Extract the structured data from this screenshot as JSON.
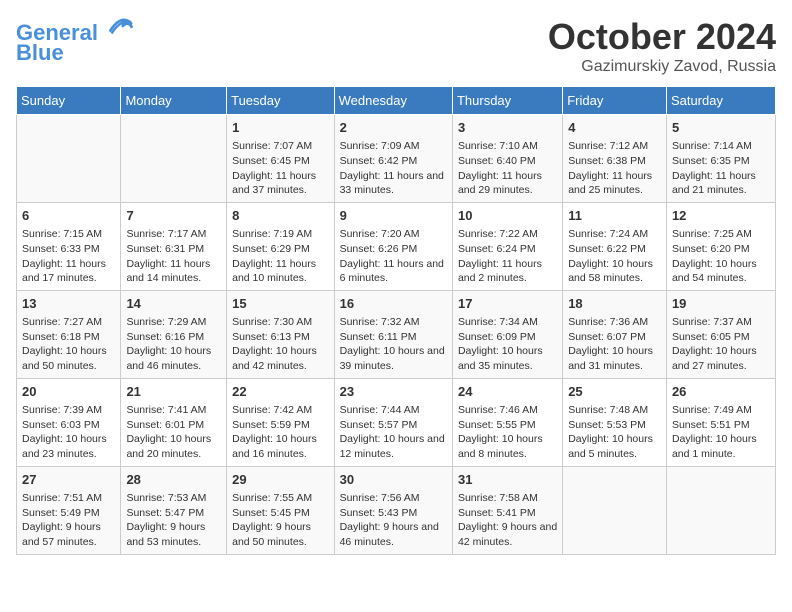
{
  "header": {
    "logo_line1": "General",
    "logo_line2": "Blue",
    "month": "October 2024",
    "location": "Gazimurskiy Zavod, Russia"
  },
  "weekdays": [
    "Sunday",
    "Monday",
    "Tuesday",
    "Wednesday",
    "Thursday",
    "Friday",
    "Saturday"
  ],
  "weeks": [
    [
      {
        "day": "",
        "detail": ""
      },
      {
        "day": "",
        "detail": ""
      },
      {
        "day": "1",
        "detail": "Sunrise: 7:07 AM\nSunset: 6:45 PM\nDaylight: 11 hours and 37 minutes."
      },
      {
        "day": "2",
        "detail": "Sunrise: 7:09 AM\nSunset: 6:42 PM\nDaylight: 11 hours and 33 minutes."
      },
      {
        "day": "3",
        "detail": "Sunrise: 7:10 AM\nSunset: 6:40 PM\nDaylight: 11 hours and 29 minutes."
      },
      {
        "day": "4",
        "detail": "Sunrise: 7:12 AM\nSunset: 6:38 PM\nDaylight: 11 hours and 25 minutes."
      },
      {
        "day": "5",
        "detail": "Sunrise: 7:14 AM\nSunset: 6:35 PM\nDaylight: 11 hours and 21 minutes."
      }
    ],
    [
      {
        "day": "6",
        "detail": "Sunrise: 7:15 AM\nSunset: 6:33 PM\nDaylight: 11 hours and 17 minutes."
      },
      {
        "day": "7",
        "detail": "Sunrise: 7:17 AM\nSunset: 6:31 PM\nDaylight: 11 hours and 14 minutes."
      },
      {
        "day": "8",
        "detail": "Sunrise: 7:19 AM\nSunset: 6:29 PM\nDaylight: 11 hours and 10 minutes."
      },
      {
        "day": "9",
        "detail": "Sunrise: 7:20 AM\nSunset: 6:26 PM\nDaylight: 11 hours and 6 minutes."
      },
      {
        "day": "10",
        "detail": "Sunrise: 7:22 AM\nSunset: 6:24 PM\nDaylight: 11 hours and 2 minutes."
      },
      {
        "day": "11",
        "detail": "Sunrise: 7:24 AM\nSunset: 6:22 PM\nDaylight: 10 hours and 58 minutes."
      },
      {
        "day": "12",
        "detail": "Sunrise: 7:25 AM\nSunset: 6:20 PM\nDaylight: 10 hours and 54 minutes."
      }
    ],
    [
      {
        "day": "13",
        "detail": "Sunrise: 7:27 AM\nSunset: 6:18 PM\nDaylight: 10 hours and 50 minutes."
      },
      {
        "day": "14",
        "detail": "Sunrise: 7:29 AM\nSunset: 6:16 PM\nDaylight: 10 hours and 46 minutes."
      },
      {
        "day": "15",
        "detail": "Sunrise: 7:30 AM\nSunset: 6:13 PM\nDaylight: 10 hours and 42 minutes."
      },
      {
        "day": "16",
        "detail": "Sunrise: 7:32 AM\nSunset: 6:11 PM\nDaylight: 10 hours and 39 minutes."
      },
      {
        "day": "17",
        "detail": "Sunrise: 7:34 AM\nSunset: 6:09 PM\nDaylight: 10 hours and 35 minutes."
      },
      {
        "day": "18",
        "detail": "Sunrise: 7:36 AM\nSunset: 6:07 PM\nDaylight: 10 hours and 31 minutes."
      },
      {
        "day": "19",
        "detail": "Sunrise: 7:37 AM\nSunset: 6:05 PM\nDaylight: 10 hours and 27 minutes."
      }
    ],
    [
      {
        "day": "20",
        "detail": "Sunrise: 7:39 AM\nSunset: 6:03 PM\nDaylight: 10 hours and 23 minutes."
      },
      {
        "day": "21",
        "detail": "Sunrise: 7:41 AM\nSunset: 6:01 PM\nDaylight: 10 hours and 20 minutes."
      },
      {
        "day": "22",
        "detail": "Sunrise: 7:42 AM\nSunset: 5:59 PM\nDaylight: 10 hours and 16 minutes."
      },
      {
        "day": "23",
        "detail": "Sunrise: 7:44 AM\nSunset: 5:57 PM\nDaylight: 10 hours and 12 minutes."
      },
      {
        "day": "24",
        "detail": "Sunrise: 7:46 AM\nSunset: 5:55 PM\nDaylight: 10 hours and 8 minutes."
      },
      {
        "day": "25",
        "detail": "Sunrise: 7:48 AM\nSunset: 5:53 PM\nDaylight: 10 hours and 5 minutes."
      },
      {
        "day": "26",
        "detail": "Sunrise: 7:49 AM\nSunset: 5:51 PM\nDaylight: 10 hours and 1 minute."
      }
    ],
    [
      {
        "day": "27",
        "detail": "Sunrise: 7:51 AM\nSunset: 5:49 PM\nDaylight: 9 hours and 57 minutes."
      },
      {
        "day": "28",
        "detail": "Sunrise: 7:53 AM\nSunset: 5:47 PM\nDaylight: 9 hours and 53 minutes."
      },
      {
        "day": "29",
        "detail": "Sunrise: 7:55 AM\nSunset: 5:45 PM\nDaylight: 9 hours and 50 minutes."
      },
      {
        "day": "30",
        "detail": "Sunrise: 7:56 AM\nSunset: 5:43 PM\nDaylight: 9 hours and 46 minutes."
      },
      {
        "day": "31",
        "detail": "Sunrise: 7:58 AM\nSunset: 5:41 PM\nDaylight: 9 hours and 42 minutes."
      },
      {
        "day": "",
        "detail": ""
      },
      {
        "day": "",
        "detail": ""
      }
    ]
  ]
}
